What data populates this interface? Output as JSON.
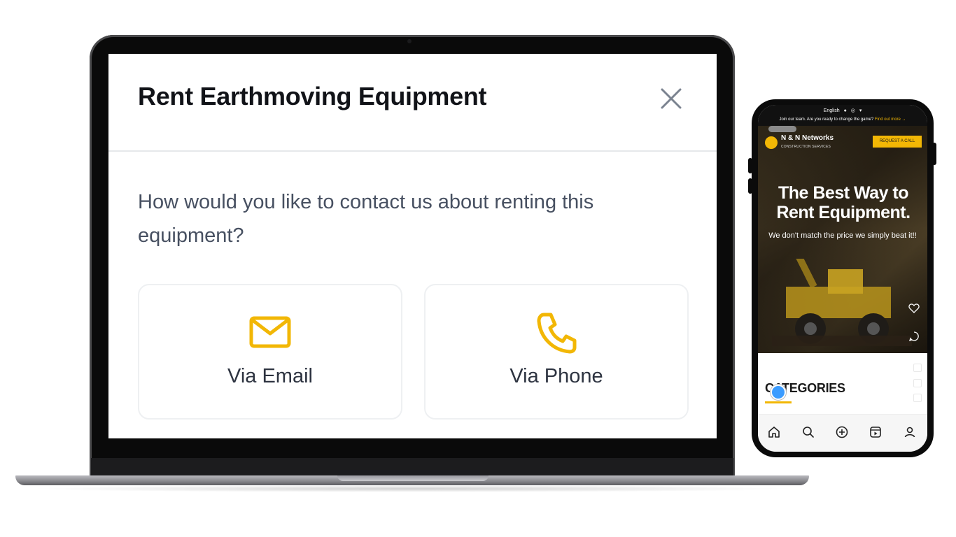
{
  "laptop": {
    "modal": {
      "title": "Rent Earthmoving Equipment",
      "question": "How would you like to contact us about renting this equipment?",
      "options": [
        {
          "label": "Via Email",
          "icon": "envelope-icon"
        },
        {
          "label": "Via Phone",
          "icon": "phone-icon"
        }
      ],
      "close_icon": "close-icon"
    },
    "colors": {
      "accent": "#f2b705",
      "title": "#111318",
      "body_text": "#475061"
    }
  },
  "phone": {
    "language": "English",
    "social_icons": [
      "facebook-icon",
      "instagram-icon",
      "twitter-icon"
    ],
    "announcement": "Join our team. Are you ready to change the game?",
    "announcement_link": "Find out more →",
    "brand": "N & N Networks",
    "brand_sub": "CONSTRUCTION SERVICES",
    "cta": "REQUEST A CALL",
    "hero_title": "The Best Way to Rent Equipment.",
    "hero_subtitle": "We don't match the price we simply beat it!!",
    "section_title": "CATEGORIES",
    "nav": [
      "home-icon",
      "search-icon",
      "add-icon",
      "reels-icon",
      "profile-icon"
    ]
  }
}
